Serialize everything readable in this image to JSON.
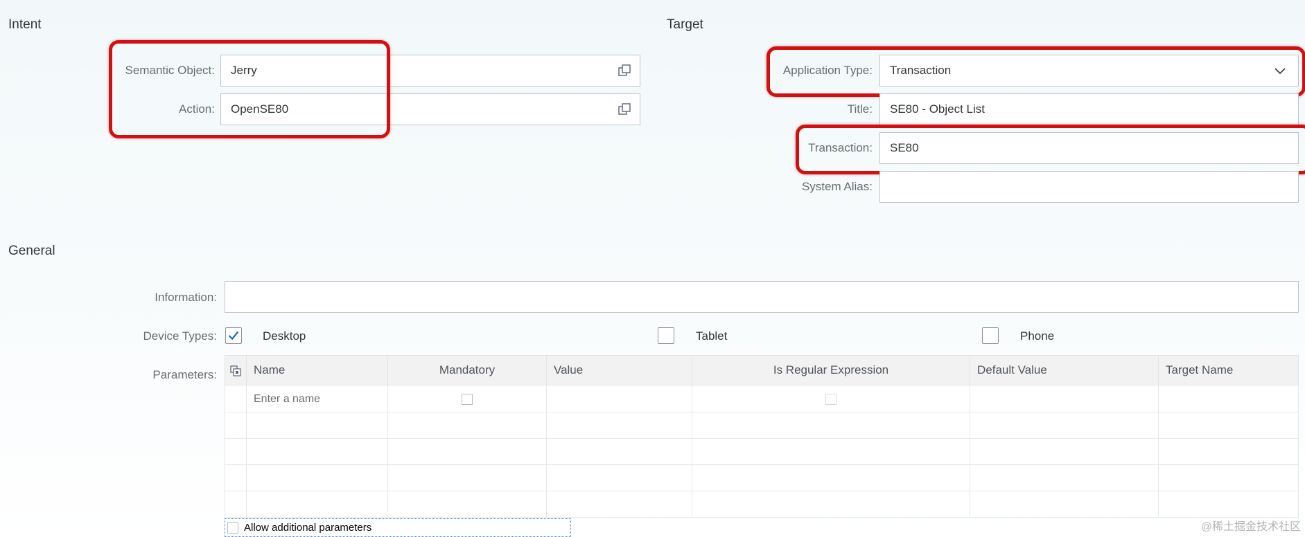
{
  "intent": {
    "title": "Intent",
    "semantic_object": {
      "label": "Semantic Object:",
      "value": "Jerry",
      "icon": "value-help-icon"
    },
    "action": {
      "label": "Action:",
      "value": "OpenSE80",
      "icon": "value-help-icon"
    }
  },
  "target": {
    "title": "Target",
    "application_type": {
      "label": "Application Type:",
      "value": "Transaction",
      "icon": "chevron-down-icon"
    },
    "title_field": {
      "label": "Title:",
      "value": "SE80 - Object List"
    },
    "transaction": {
      "label": "Transaction:",
      "value": "SE80"
    },
    "system_alias": {
      "label": "System Alias:",
      "value": ""
    }
  },
  "general": {
    "title": "General",
    "information": {
      "label": "Information:",
      "value": ""
    },
    "device_types": {
      "label": "Device Types:",
      "desktop": {
        "label": "Desktop",
        "checked": true
      },
      "tablet": {
        "label": "Tablet",
        "checked": false
      },
      "phone": {
        "label": "Phone",
        "checked": false
      }
    },
    "parameters": {
      "label": "Parameters:",
      "columns": [
        "Name",
        "Mandatory",
        "Value",
        "Is Regular Expression",
        "Default Value",
        "Target Name"
      ],
      "name_placeholder": "Enter a name",
      "empty_rows": 4
    },
    "allow_additional": {
      "label": "Allow additional parameters",
      "checked": false
    }
  },
  "watermark": "@稀土掘金技术社区",
  "colors": {
    "highlight": "#d50f0f",
    "check": "#0a6ed1",
    "field_border": "#bfc4c8"
  }
}
